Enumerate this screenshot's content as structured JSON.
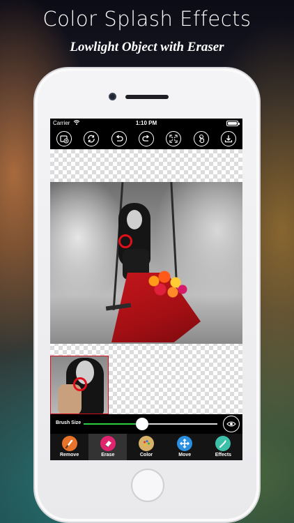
{
  "promo": {
    "title": "Color Splash Effects",
    "subtitle": "Lowlight Object with Eraser"
  },
  "statusbar": {
    "carrier": "Carrier",
    "time": "1:10 PM"
  },
  "toolbar": {
    "buttons": [
      {
        "name": "add-photo-icon"
      },
      {
        "name": "refresh-icon"
      },
      {
        "name": "undo-icon"
      },
      {
        "name": "redo-icon"
      },
      {
        "name": "fit-screen-icon"
      },
      {
        "name": "touch-pan-icon"
      },
      {
        "name": "save-download-icon"
      }
    ]
  },
  "brush": {
    "label": "Brush Size",
    "value_fraction": 0.44
  },
  "bottom_nav": {
    "items": [
      {
        "label": "Remove",
        "icon": "brush-icon",
        "color": "#e8732a",
        "active": false
      },
      {
        "label": "Erase",
        "icon": "eraser-icon",
        "color": "#e0246e",
        "active": true
      },
      {
        "label": "Color",
        "icon": "palette-icon",
        "color": "#d9b26a",
        "active": false
      },
      {
        "label": "Move",
        "icon": "move-arrows-icon",
        "color": "#2b8fe0",
        "active": false
      },
      {
        "label": "Effects",
        "icon": "magic-wand-icon",
        "color": "#3cc0a8",
        "active": false
      }
    ]
  },
  "colors": {
    "accent_green": "#2ecc40",
    "cursor_red": "#e0101a",
    "dress_red": "#c4161c"
  }
}
